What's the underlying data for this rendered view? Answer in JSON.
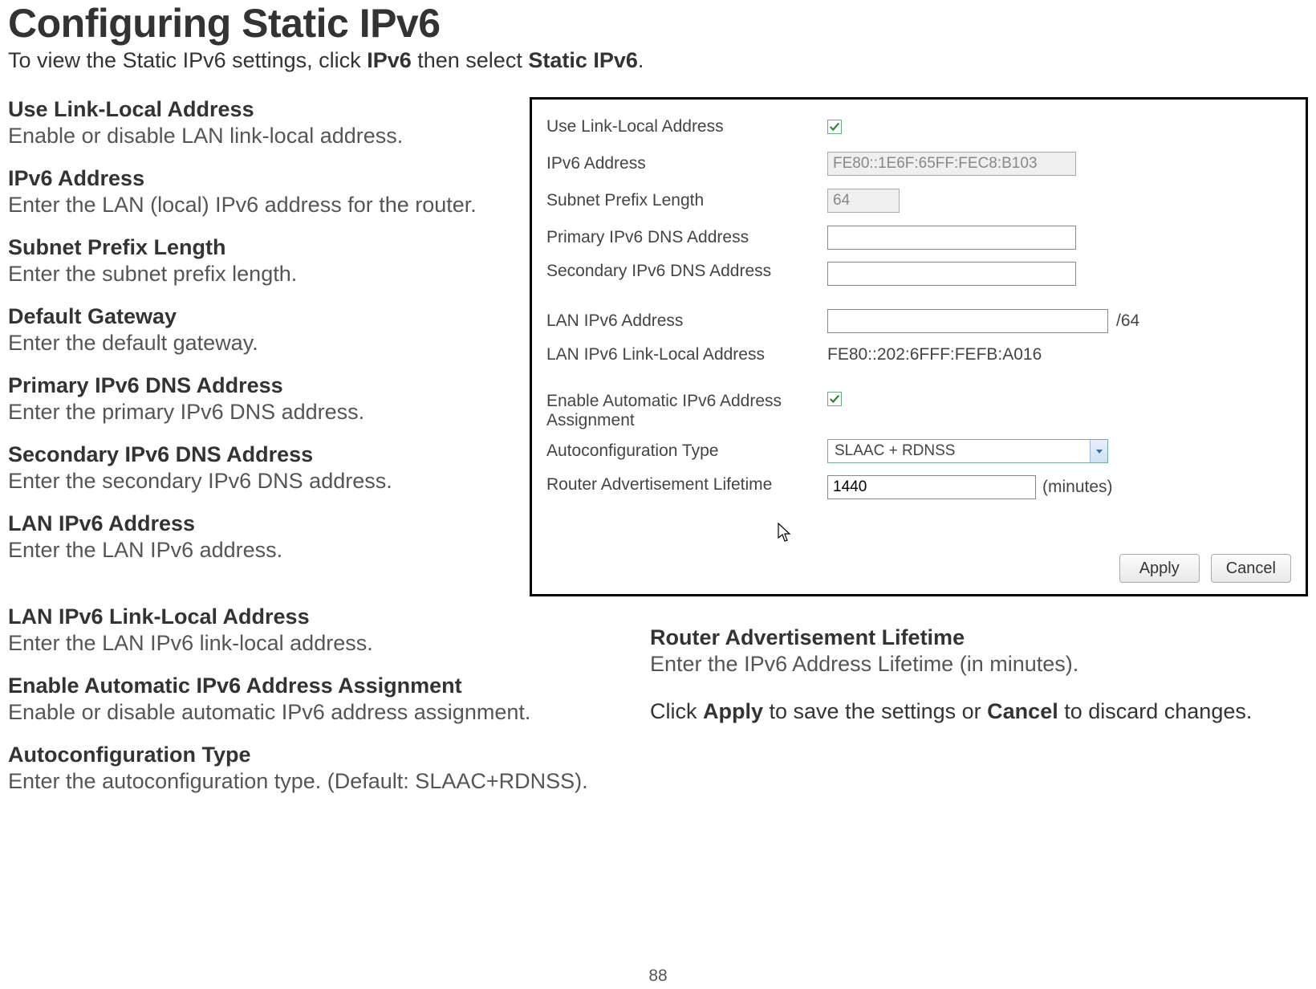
{
  "page": {
    "title": "Configuring Static IPv6",
    "subtitle_pre": "To view the Static IPv6 settings, click ",
    "subtitle_b1": "IPv6",
    "subtitle_mid": " then select ",
    "subtitle_b2": "Static IPv6",
    "subtitle_post": ".",
    "number": "88"
  },
  "definitions": [
    {
      "title": "Use Link-Local Address",
      "body": "Enable or disable LAN link-local address."
    },
    {
      "title": "IPv6 Address",
      "body": "Enter the LAN (local) IPv6 address for the router."
    },
    {
      "title": "Subnet Prefix Length",
      "body": "Enter the subnet prefix length."
    },
    {
      "title": "Default Gateway",
      "body": "Enter the default gateway."
    },
    {
      "title": "Primary IPv6 DNS Address",
      "body": "Enter the primary IPv6 DNS address."
    },
    {
      "title": "Secondary IPv6 DNS Address",
      "body": "Enter the secondary IPv6 DNS address."
    },
    {
      "title": "LAN IPv6 Address",
      "body": "Enter the LAN IPv6 address."
    },
    {
      "title": "LAN IPv6 Link-Local Address",
      "body": "Enter the LAN IPv6 link-local address."
    },
    {
      "title": "Enable Automatic IPv6 Address Assignment",
      "body": "Enable or disable automatic IPv6 address assignment."
    },
    {
      "title": "Autoconfiguration Type",
      "body": "Enter the autoconfiguration type. (Default: SLAAC+RDNSS)."
    }
  ],
  "right_defs": {
    "ral_title": "Router Advertisement Lifetime",
    "ral_body": "Enter the IPv6 Address Lifetime (in minutes).",
    "click_pre": "Click ",
    "click_b1": "Apply",
    "click_mid": " to save the settings or ",
    "click_b2": "Cancel",
    "click_post": " to discard changes."
  },
  "panel": {
    "use_link_local_label": "Use Link-Local Address",
    "use_link_local_checked": true,
    "ipv6_address_label": "IPv6 Address",
    "ipv6_address_value": "FE80::1E6F:65FF:FEC8:B103",
    "subnet_prefix_label": "Subnet Prefix Length",
    "subnet_prefix_value": "64",
    "primary_dns_label": "Primary IPv6 DNS Address",
    "primary_dns_value": "",
    "secondary_dns_label": "Secondary IPv6 DNS Address",
    "secondary_dns_value": "",
    "lan_ipv6_label": "LAN IPv6 Address",
    "lan_ipv6_value": "",
    "lan_ipv6_suffix": "/64",
    "lan_linklocal_label": "LAN IPv6 Link-Local Address",
    "lan_linklocal_value": "FE80::202:6FFF:FEFB:A016",
    "enable_auto_label": "Enable Automatic IPv6 Address Assignment",
    "enable_auto_checked": true,
    "autoconfig_label": "Autoconfiguration Type",
    "autoconfig_value": "SLAAC + RDNSS",
    "ra_lifetime_label": "Router Advertisement Lifetime",
    "ra_lifetime_value": "1440",
    "ra_lifetime_units": "(minutes)",
    "apply_label": "Apply",
    "cancel_label": "Cancel"
  }
}
